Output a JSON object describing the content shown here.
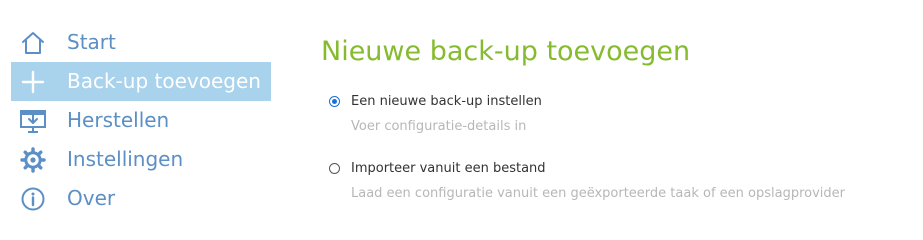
{
  "sidebar": {
    "items": [
      {
        "label": "Start",
        "icon": "home-icon",
        "active": false
      },
      {
        "label": "Back-up toevoegen",
        "icon": "plus-icon",
        "active": true
      },
      {
        "label": "Herstellen",
        "icon": "restore-icon",
        "active": false
      },
      {
        "label": "Instellingen",
        "icon": "gear-icon",
        "active": false
      },
      {
        "label": "Over",
        "icon": "info-icon",
        "active": false
      }
    ]
  },
  "main": {
    "title": "Nieuwe back-up toevoegen",
    "options": [
      {
        "label": "Een nieuwe back-up instellen",
        "description": "Voer configuratie-details in",
        "checked": true
      },
      {
        "label": "Importeer vanuit een bestand",
        "description": "Laad een configuratie vanuit een geëxporteerde taak of een opslagprovider",
        "checked": false
      }
    ]
  },
  "colors": {
    "accent_green": "#86bb2f",
    "nav_blue": "#5b8fc6",
    "active_bg": "#a9d2ec",
    "radio_blue": "#1a6fd6"
  }
}
